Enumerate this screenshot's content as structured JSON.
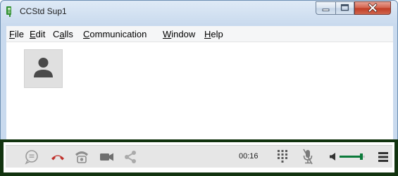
{
  "window": {
    "title": "CCStd Sup1",
    "icon": "app-icon",
    "controls": [
      "minimize-icon",
      "maximize-icon",
      "close-icon"
    ]
  },
  "menubar": {
    "items": [
      {
        "accel": "F",
        "rest": "ile"
      },
      {
        "accel": "E",
        "rest": "dit"
      },
      {
        "pre": "C",
        "accel": "a",
        "rest": "lls"
      },
      {
        "accel": "C",
        "rest": "ommunication"
      },
      {
        "accel": "W",
        "rest": "indow"
      },
      {
        "accel": "H",
        "rest": "elp"
      }
    ]
  },
  "participant": {
    "avatar_icon": "person-icon"
  },
  "toolbar": {
    "call_timer": "00:16",
    "icons": [
      "chat-icon",
      "hang-up-icon",
      "phone-icon",
      "video-camera-icon",
      "share-icon",
      "dialpad-icon",
      "microphone-muted-icon",
      "volume-icon",
      "menu-icon"
    ],
    "volume_level": 0.85
  },
  "colors": {
    "hang_up": "#c0302a",
    "volume_accent": "#0b7a3a",
    "toolbar_frame": "#12330f",
    "toolbar_icons": "#8d8d8d"
  }
}
